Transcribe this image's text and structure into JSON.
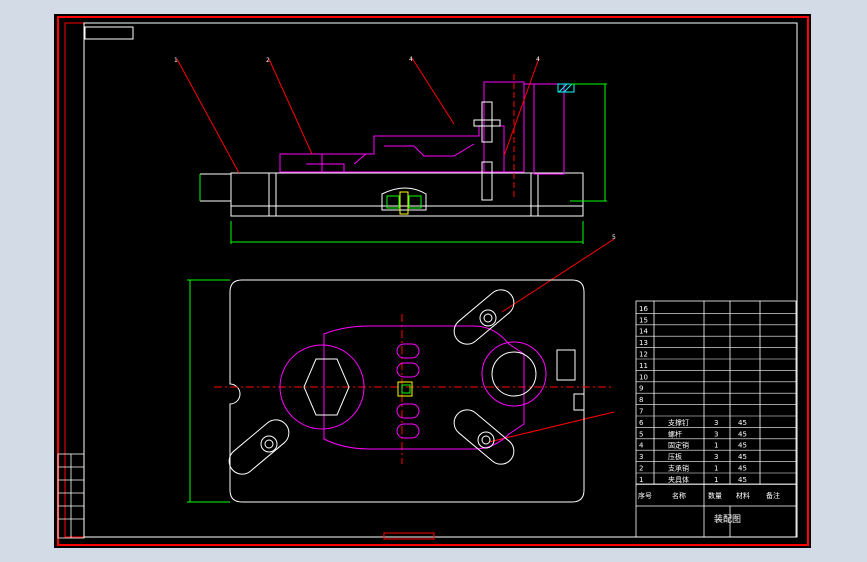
{
  "drawing": {
    "title": "装配图",
    "balloons": [
      "1",
      "2",
      "4",
      "4",
      "5"
    ],
    "bom_rows": [
      {
        "no": "16",
        "name": "",
        "qty": "",
        "mat": ""
      },
      {
        "no": "15",
        "name": "",
        "qty": "",
        "mat": ""
      },
      {
        "no": "14",
        "name": "",
        "qty": "",
        "mat": ""
      },
      {
        "no": "13",
        "name": "",
        "qty": "",
        "mat": ""
      },
      {
        "no": "12",
        "name": "",
        "qty": "",
        "mat": ""
      },
      {
        "no": "11",
        "name": "",
        "qty": "",
        "mat": ""
      },
      {
        "no": "10",
        "name": "",
        "qty": "",
        "mat": ""
      },
      {
        "no": "9",
        "name": "",
        "qty": "",
        "mat": ""
      },
      {
        "no": "8",
        "name": "",
        "qty": "",
        "mat": ""
      },
      {
        "no": "7",
        "name": "",
        "qty": "",
        "mat": ""
      },
      {
        "no": "6",
        "name": "支撑钉",
        "qty": "3",
        "mat": "45"
      },
      {
        "no": "5",
        "name": "螺杆",
        "qty": "3",
        "mat": "45"
      },
      {
        "no": "4",
        "name": "固定销",
        "qty": "1",
        "mat": "45"
      },
      {
        "no": "3",
        "name": "压板",
        "qty": "3",
        "mat": "45"
      },
      {
        "no": "2",
        "name": "支承销",
        "qty": "1",
        "mat": "45"
      },
      {
        "no": "1",
        "name": "夹具体",
        "qty": "1",
        "mat": "45"
      }
    ],
    "bom_header": {
      "no": "序号",
      "name": "名称",
      "qty": "数量",
      "mat": "材料",
      "note": "备注"
    },
    "colors": {
      "sheet": "#000000",
      "border": "#ff0000",
      "outline": "#ffffff",
      "part": "#ff00ff",
      "dimension": "#00ff00",
      "hatch": "#00ffff",
      "pin": "#ffff00"
    }
  }
}
